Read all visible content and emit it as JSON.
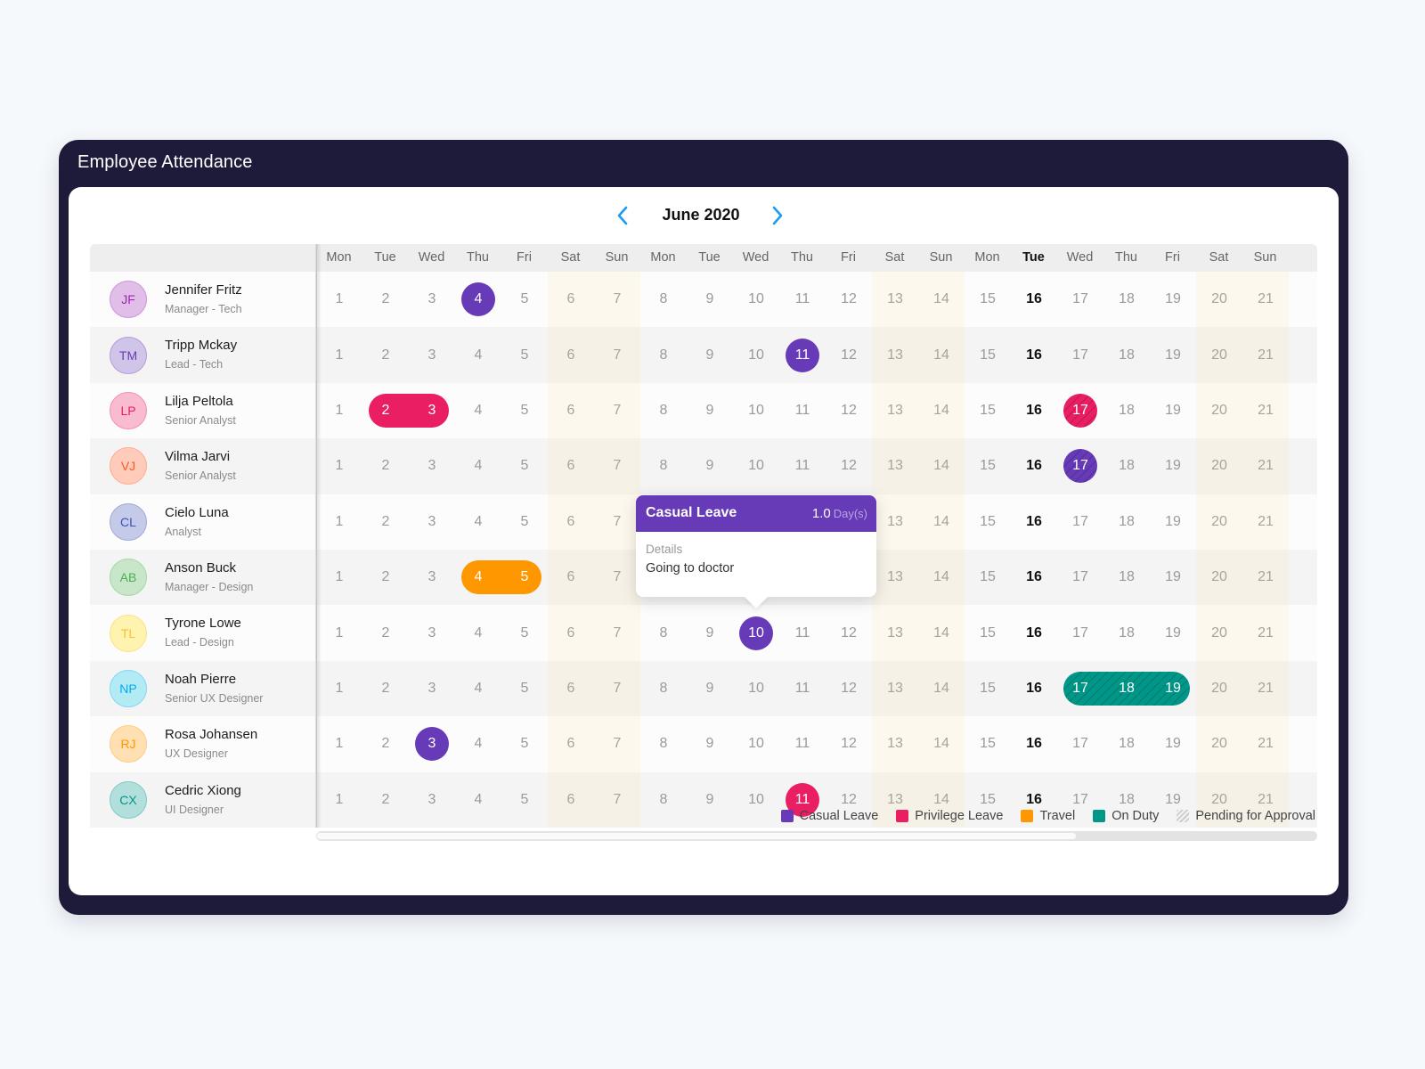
{
  "window": {
    "title": "Employee Attendance"
  },
  "calendar": {
    "month_label": "June 2020",
    "prev_icon": "chevron-left-icon",
    "next_icon": "chevron-right-icon",
    "accent_color": "#1e9bf0",
    "today": 16,
    "days": [
      {
        "dow": "Mon",
        "date": 1
      },
      {
        "dow": "Tue",
        "date": 2
      },
      {
        "dow": "Wed",
        "date": 3
      },
      {
        "dow": "Thu",
        "date": 4
      },
      {
        "dow": "Fri",
        "date": 5
      },
      {
        "dow": "Sat",
        "date": 6
      },
      {
        "dow": "Sun",
        "date": 7
      },
      {
        "dow": "Mon",
        "date": 8
      },
      {
        "dow": "Tue",
        "date": 9
      },
      {
        "dow": "Wed",
        "date": 10
      },
      {
        "dow": "Thu",
        "date": 11
      },
      {
        "dow": "Fri",
        "date": 12
      },
      {
        "dow": "Sat",
        "date": 13
      },
      {
        "dow": "Sun",
        "date": 14
      },
      {
        "dow": "Mon",
        "date": 15
      },
      {
        "dow": "Tue",
        "date": 16
      },
      {
        "dow": "Wed",
        "date": 17
      },
      {
        "dow": "Thu",
        "date": 18
      },
      {
        "dow": "Fri",
        "date": 19
      },
      {
        "dow": "Sat",
        "date": 20
      },
      {
        "dow": "Sun",
        "date": 21
      }
    ]
  },
  "leave_types": {
    "casual": {
      "label": "Casual Leave",
      "color": "#673ab7"
    },
    "privilege": {
      "label": "Privilege Leave",
      "color": "#e91e63"
    },
    "travel": {
      "label": "Travel",
      "color": "#ff9800"
    },
    "onduty": {
      "label": "On Duty",
      "color": "#009688"
    },
    "pending": {
      "label": "Pending for Approval",
      "color": "#cccccc"
    }
  },
  "employees": [
    {
      "initials": "JF",
      "name": "Jennifer Fritz",
      "role": "Manager - Tech",
      "avatar_bg": "#e1bee7",
      "avatar_fg": "#9c27b0",
      "avatar_border": "#ce93d8",
      "leaves": [
        {
          "type": "casual",
          "from": 4,
          "to": 4,
          "pending": false
        }
      ]
    },
    {
      "initials": "TM",
      "name": "Tripp Mckay",
      "role": "Lead - Tech",
      "avatar_bg": "#d1c4e9",
      "avatar_fg": "#673ab7",
      "avatar_border": "#b39ddb",
      "leaves": [
        {
          "type": "casual",
          "from": 11,
          "to": 11,
          "pending": false
        }
      ]
    },
    {
      "initials": "LP",
      "name": "Lilja Peltola",
      "role": "Senior Analyst",
      "avatar_bg": "#f8bbd0",
      "avatar_fg": "#e91e63",
      "avatar_border": "#f48fb1",
      "leaves": [
        {
          "type": "privilege",
          "from": 2,
          "to": 3,
          "pending": false
        },
        {
          "type": "privilege",
          "from": 17,
          "to": 17,
          "pending": true
        }
      ]
    },
    {
      "initials": "VJ",
      "name": "Vilma Jarvi",
      "role": "Senior Analyst",
      "avatar_bg": "#ffccbc",
      "avatar_fg": "#ff5722",
      "avatar_border": "#ffab91",
      "leaves": [
        {
          "type": "casual",
          "from": 17,
          "to": 17,
          "pending": true
        }
      ]
    },
    {
      "initials": "CL",
      "name": "Cielo Luna",
      "role": "Analyst",
      "avatar_bg": "#c5cae9",
      "avatar_fg": "#3f51b5",
      "avatar_border": "#9fa8da",
      "leaves": []
    },
    {
      "initials": "AB",
      "name": "Anson Buck",
      "role": "Manager - Design",
      "avatar_bg": "#c8e6c9",
      "avatar_fg": "#4caf50",
      "avatar_border": "#a5d6a7",
      "leaves": [
        {
          "type": "travel",
          "from": 4,
          "to": 5,
          "pending": false
        }
      ]
    },
    {
      "initials": "TL",
      "name": "Tyrone Lowe",
      "role": "Lead - Design",
      "avatar_bg": "#fff3b0",
      "avatar_fg": "#fbc02d",
      "avatar_border": "#ffe082",
      "leaves": [
        {
          "type": "casual",
          "from": 10,
          "to": 10,
          "pending": false
        }
      ]
    },
    {
      "initials": "NP",
      "name": "Noah Pierre",
      "role": "Senior UX Designer",
      "avatar_bg": "#b3ebf5",
      "avatar_fg": "#03a9f4",
      "avatar_border": "#81d4fa",
      "leaves": [
        {
          "type": "onduty",
          "from": 17,
          "to": 19,
          "pending": true
        }
      ]
    },
    {
      "initials": "RJ",
      "name": "Rosa Johansen",
      "role": "UX Designer",
      "avatar_bg": "#ffe0b2",
      "avatar_fg": "#ff9800",
      "avatar_border": "#ffcc80",
      "leaves": [
        {
          "type": "casual",
          "from": 3,
          "to": 3,
          "pending": false
        }
      ]
    },
    {
      "initials": "CX",
      "name": "Cedric Xiong",
      "role": "UI Designer",
      "avatar_bg": "#b2dfdb",
      "avatar_fg": "#009688",
      "avatar_border": "#80cbc4",
      "leaves": [
        {
          "type": "privilege",
          "from": 11,
          "to": 11,
          "pending": false
        }
      ]
    }
  ],
  "tooltip": {
    "title": "Casual Leave",
    "amount": "1.0",
    "unit": "Day(s)",
    "details_label": "Details",
    "details_value": "Going to doctor",
    "employee_index": 6,
    "date": 10
  },
  "legend": [
    {
      "key": "casual",
      "label": "Casual Leave"
    },
    {
      "key": "privilege",
      "label": "Privilege Leave"
    },
    {
      "key": "travel",
      "label": "Travel"
    },
    {
      "key": "onduty",
      "label": "On Duty"
    },
    {
      "key": "pending",
      "label": "Pending for Approval"
    }
  ],
  "scroll": {
    "horizontal_position": 0.0,
    "visible_fraction": 0.76
  }
}
